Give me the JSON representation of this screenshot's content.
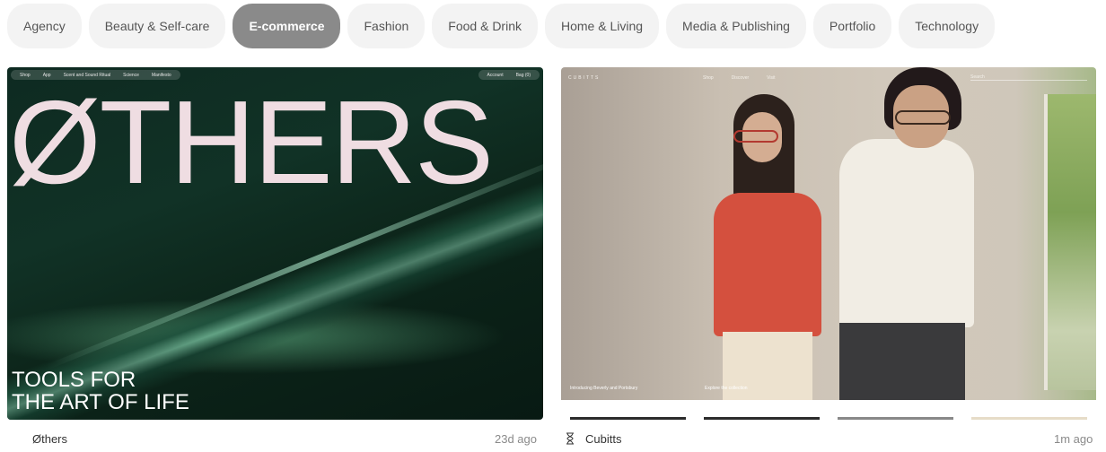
{
  "categories": [
    {
      "label": "Agency",
      "active": false
    },
    {
      "label": "Beauty & Self-care",
      "active": false
    },
    {
      "label": "E-commerce",
      "active": true
    },
    {
      "label": "Fashion",
      "active": false
    },
    {
      "label": "Food & Drink",
      "active": false
    },
    {
      "label": "Home & Living",
      "active": false
    },
    {
      "label": "Media & Publishing",
      "active": false
    },
    {
      "label": "Portfolio",
      "active": false
    },
    {
      "label": "Technology",
      "active": false
    }
  ],
  "cards": [
    {
      "name": "Øthers",
      "time": "23d ago",
      "preview": {
        "nav_left": [
          "Shop",
          "App",
          "Scent and Sound Ritual",
          "Science",
          "Manifesto"
        ],
        "nav_right": [
          "Account",
          "Bag (0)"
        ],
        "brand": "ØTHERS",
        "tagline_line1": "TOOLS FOR",
        "tagline_line2": "THE ART OF LIFE"
      }
    },
    {
      "name": "Cubitts",
      "time": "1m ago",
      "preview": {
        "logo": "CUBITTS",
        "nav": [
          "Shop",
          "Discover",
          "Visit"
        ],
        "search": "Search",
        "caption_left": "Introducing Beverly and Portsbury",
        "caption_right": "Explore the collection"
      }
    }
  ],
  "colors": {
    "chip_bg": "#f3f3f3",
    "chip_active_bg": "#8a8a8a",
    "brand_text": "#efdde2"
  }
}
